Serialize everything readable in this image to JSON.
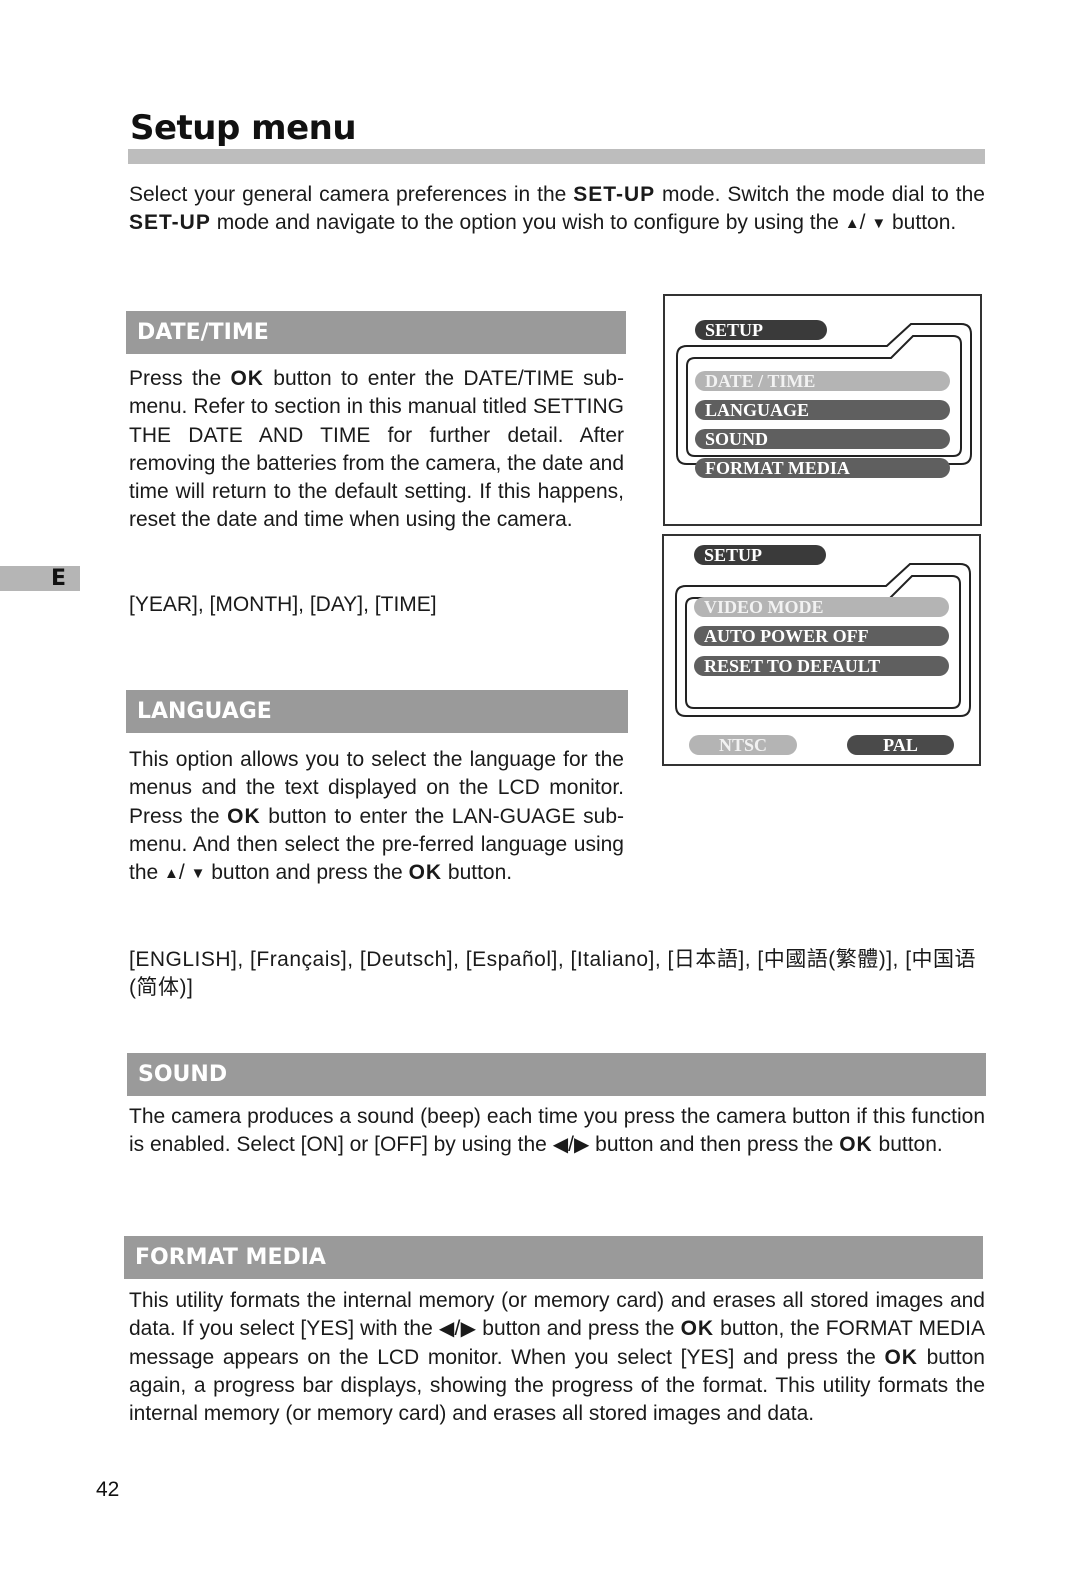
{
  "page": {
    "title": "Setup menu",
    "side_tab": "E",
    "page_number": "42"
  },
  "intro": {
    "t1": "Select your general camera preferences  in the ",
    "b1": "SET-UP",
    "t2": " mode. Switch the mode dial to the ",
    "b2": "SET-UP",
    "t3": " mode and navigate to the option you wish to configure by using the ",
    "up_icon": "▲",
    "slash": "/ ",
    "down_icon": "▼",
    "t4": " button."
  },
  "sections": {
    "datetime": {
      "heading": "DATE/TIME",
      "t1": "Press the ",
      "ok": "OK",
      "t2": " button to enter the DATE/TIME sub-menu. Refer to section in this manual titled SETTING THE DATE AND TIME for further detail. After removing the batteries from the camera, the date and time will return to the default setting. If this happens, reset the date and time when using the camera.",
      "options": "[YEAR], [MONTH], [DAY], [TIME]"
    },
    "language": {
      "heading": "LANGUAGE",
      "t1": "This option allows you to select the language for the menus and the text displayed on the LCD monitor. Press the ",
      "ok1": "OK",
      "t2": " button to enter the LAN-GUAGE sub-menu. And then select the pre-ferred language using the ",
      "up_icon": "▲",
      "slash": "/ ",
      "down_icon": "▼",
      "t3": " button and press the ",
      "ok2": "OK",
      "t4": " button.",
      "options": "[ENGLISH], [Français], [Deutsch], [Español], [Italiano], [日本語], [中國語(繁體)], [中国语(简体)]"
    },
    "sound": {
      "heading": "SOUND",
      "t1": "The camera produces a sound (beep) each time you press the camera button if this function is enabled. Select [ON] or [OFF] by using the ",
      "left_icon": "◀",
      "slash": "/",
      "right_icon": "▶",
      "t2": " button and then press the ",
      "ok": "OK",
      "t3": " button."
    },
    "format": {
      "heading": "FORMAT MEDIA",
      "t1": "This utility formats the internal memory (or memory card) and erases all stored images and data. If you select [YES] with the ",
      "left_icon": "◀",
      "slash": "/",
      "right_icon": "▶",
      "t2": " button and press the ",
      "ok1": "OK",
      "t3": " button, the FORMAT MEDIA message appears on the LCD monitor. When you select [YES] and press the ",
      "ok2": "OK",
      "t4": " button again, a progress bar displays, showing the progress of the format. This utility formats the internal memory (or memory card) and erases all stored images and data."
    }
  },
  "lcd1": {
    "header": "SETUP",
    "items": [
      {
        "label": "DATE / TIME",
        "state": "selected"
      },
      {
        "label": "LANGUAGE",
        "state": "normal"
      },
      {
        "label": "SOUND",
        "state": "normal"
      },
      {
        "label": "FORMAT  MEDIA",
        "state": "normal"
      }
    ]
  },
  "lcd2": {
    "header": "SETUP",
    "items": [
      {
        "label": "VIDEO  MODE",
        "state": "selected"
      },
      {
        "label": "AUTO  POWER  OFF",
        "state": "normal"
      },
      {
        "label": "RESET  TO  DEFAULT",
        "state": "normal"
      }
    ],
    "options": [
      {
        "label": "NTSC",
        "state": "light"
      },
      {
        "label": "PAL",
        "state": "dark"
      }
    ]
  }
}
